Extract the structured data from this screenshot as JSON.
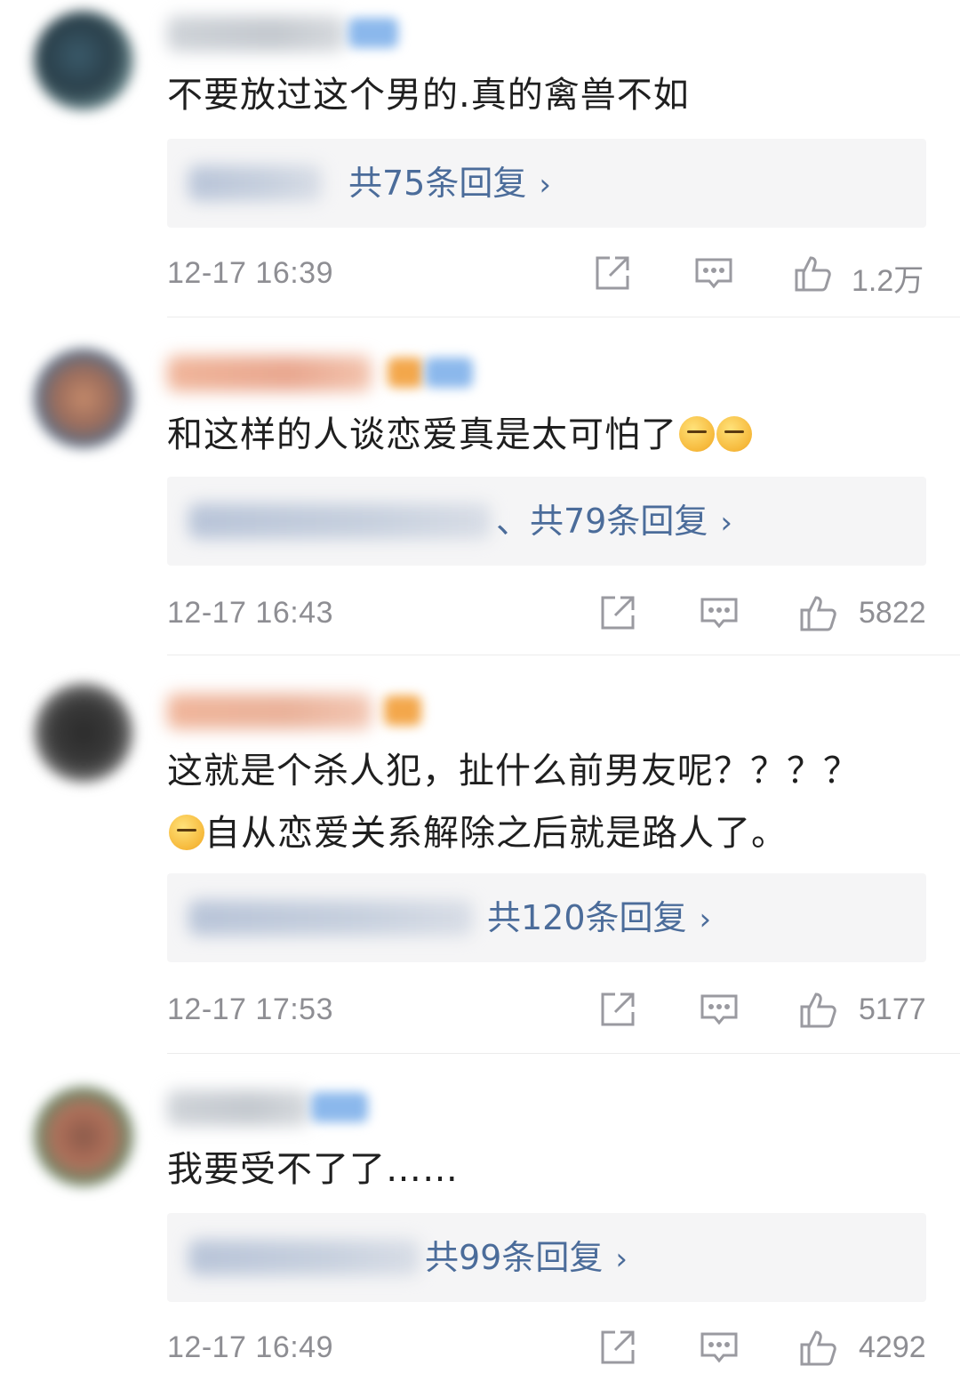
{
  "comments": [
    {
      "text": "不要放过这个男的.真的禽兽不如",
      "reply_link": "共75条回复",
      "time": "12-17 16:39",
      "likes": "1.2万"
    },
    {
      "text": "和这样的人谈恋爱真是太可怕了",
      "reply_link": "、共79条回复",
      "time": "12-17 16:43",
      "likes": "5822"
    },
    {
      "text_line1": "这就是个杀人犯，扯什么前男友呢？？？？",
      "text_line2": "自从恋爱关系解除之后就是路人了。",
      "reply_link": "共120条回复",
      "time": "12-17 17:53",
      "likes": "5177"
    },
    {
      "text": "我要受不了了……",
      "reply_link": "共99条回复",
      "time": "12-17 16:49",
      "likes": "4292"
    }
  ],
  "icons": {
    "share": "share-icon",
    "comment": "comment-icon",
    "like": "thumbs-up-icon",
    "chevron": "chevron-right-icon"
  },
  "colors": {
    "link": "#4b6c9a",
    "meta": "#8e8e93",
    "reply_bg": "#f5f5f6"
  }
}
